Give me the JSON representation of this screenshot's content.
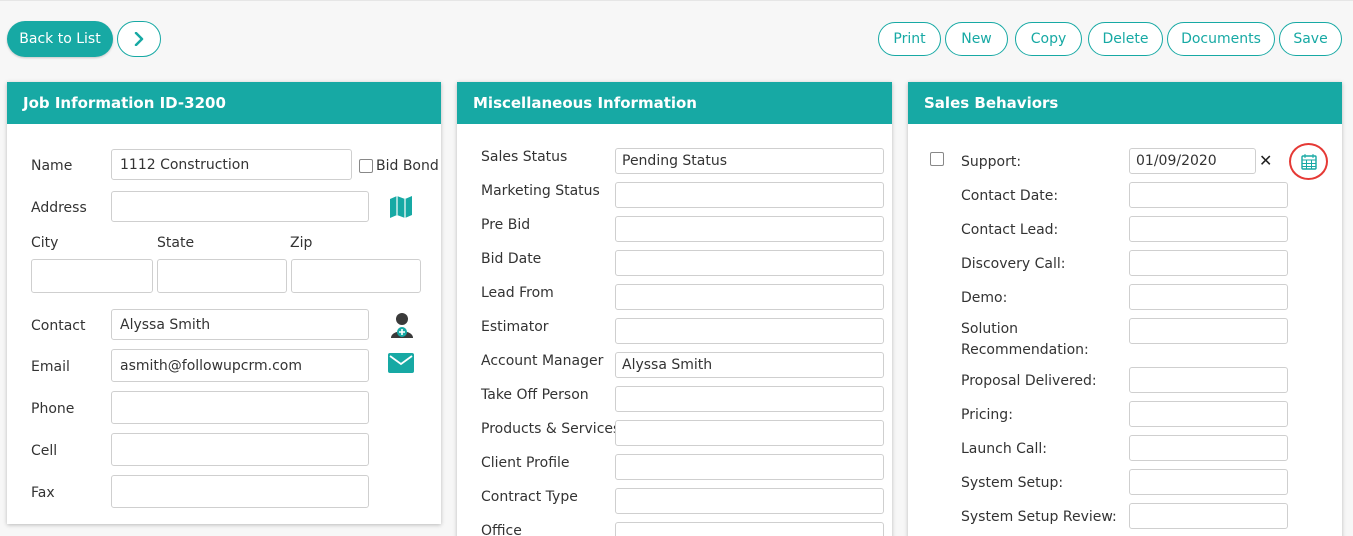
{
  "toolbar": {
    "back_label": "Back to List",
    "print": "Print",
    "new": "New",
    "copy": "Copy",
    "delete": "Delete",
    "documents": "Documents",
    "save": "Save"
  },
  "job_info": {
    "title": "Job Information ID-3200",
    "name_label": "Name",
    "name_value": "1112 Construction",
    "bid_bond_label": "Bid Bond",
    "address_label": "Address",
    "address_value": "",
    "city_label": "City",
    "state_label": "State",
    "zip_label": "Zip",
    "contact_label": "Contact",
    "contact_value": "Alyssa Smith",
    "email_label": "Email",
    "email_value": "asmith@followupcrm.com",
    "phone_label": "Phone",
    "cell_label": "Cell",
    "fax_label": "Fax"
  },
  "misc": {
    "title": "Miscellaneous Information",
    "fields": [
      {
        "label": "Sales Status",
        "value": "Pending Status"
      },
      {
        "label": "Marketing Status",
        "value": ""
      },
      {
        "label": "Pre Bid",
        "value": ""
      },
      {
        "label": "Bid Date",
        "value": ""
      },
      {
        "label": "Lead From",
        "value": ""
      },
      {
        "label": "Estimator",
        "value": ""
      },
      {
        "label": "Account Manager",
        "value": "Alyssa Smith"
      },
      {
        "label": "Take Off Person",
        "value": ""
      },
      {
        "label": "Products & Services",
        "value": ""
      },
      {
        "label": "Client Profile",
        "value": ""
      },
      {
        "label": "Contract Type",
        "value": ""
      },
      {
        "label": "Office",
        "value": ""
      }
    ]
  },
  "sales": {
    "title": "Sales Behaviors",
    "support_label": "Support:",
    "support_value": "01/09/2020",
    "clear_symbol": "✕",
    "fields": [
      {
        "label": "Contact Date:",
        "value": ""
      },
      {
        "label": "Contact Lead:",
        "value": ""
      },
      {
        "label": "Discovery Call:",
        "value": ""
      },
      {
        "label": "Demo:",
        "value": ""
      },
      {
        "label_line1": "Solution",
        "label_line2": "Recommendation:",
        "value": ""
      },
      {
        "label": "Proposal Delivered:",
        "value": ""
      },
      {
        "label": "Pricing:",
        "value": ""
      },
      {
        "label": "Launch Call:",
        "value": ""
      },
      {
        "label": "System Setup:",
        "value": ""
      },
      {
        "label": "System Setup Review:",
        "value": ""
      }
    ]
  },
  "colors": {
    "accent": "#17a9a4",
    "highlight_ring": "#e53935"
  }
}
